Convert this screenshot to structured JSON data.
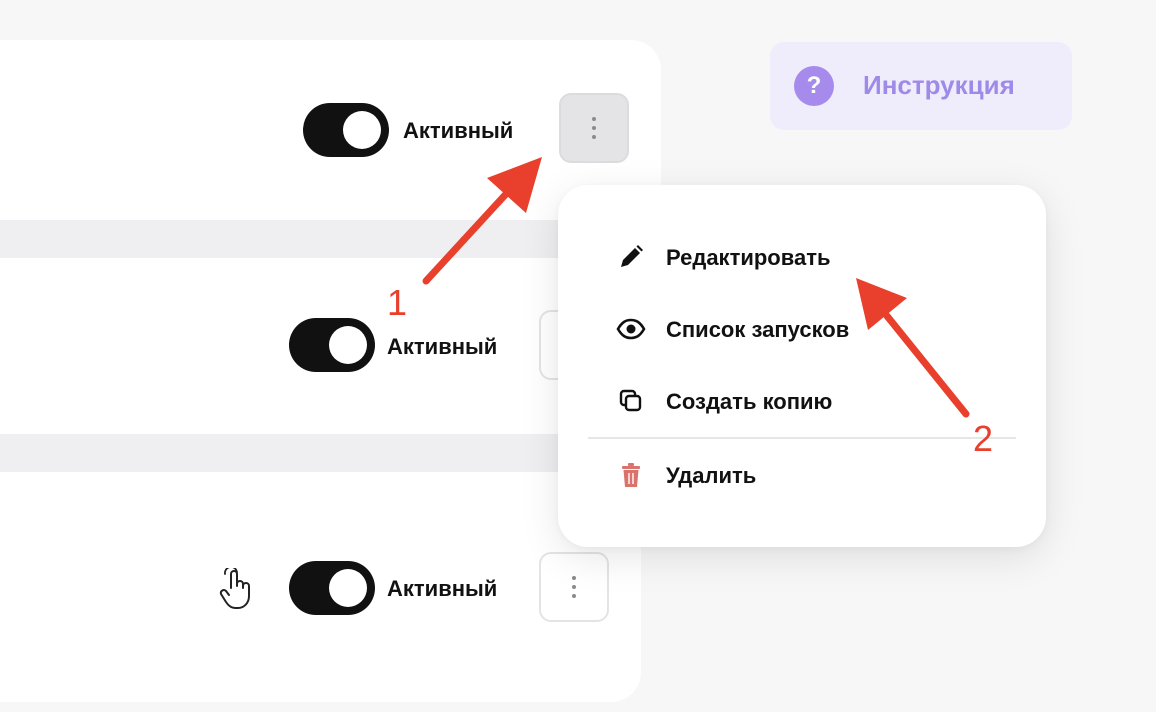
{
  "instruction_button": {
    "icon": "question-icon",
    "icon_glyph": "?",
    "label": "Инструкция",
    "accent_color": "#a78bec"
  },
  "rows": [
    {
      "status_label": "Активный",
      "toggle_on": true
    },
    {
      "status_label": "Активный",
      "toggle_on": true
    },
    {
      "status_label": "Активный",
      "toggle_on": true
    }
  ],
  "context_menu": {
    "items": [
      {
        "label": "Редактировать",
        "icon": "pencil-icon"
      },
      {
        "label": "Список запусков",
        "icon": "eye-icon"
      },
      {
        "label": "Создать копию",
        "icon": "copy-icon"
      },
      {
        "label": "Удалить",
        "icon": "trash-icon",
        "color": "#d9736b"
      }
    ]
  },
  "annotations": {
    "step_1": "1",
    "step_2": "2",
    "color": "#e8402c"
  }
}
